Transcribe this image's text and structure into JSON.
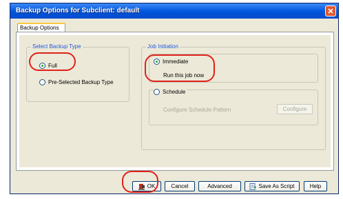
{
  "window": {
    "title": "Backup Options for Subclient: default"
  },
  "tabs": [
    {
      "label": "Backup Options",
      "selected": true
    }
  ],
  "backup_type": {
    "group_title": "Select Backup Type",
    "options": [
      {
        "label": "Full",
        "checked": true
      },
      {
        "label": "Pre-Selected Backup Type",
        "checked": false
      }
    ]
  },
  "job_initiation": {
    "group_title": "Job Initiation",
    "immediate_label": "Immediate",
    "immediate_checked": true,
    "immediate_desc": "Run this job now",
    "schedule_label": "Schedule",
    "schedule_checked": false,
    "schedule_desc": "Configure Schedule Pattern",
    "configure_label": "Configure"
  },
  "footer": {
    "ok_label": "OK",
    "cancel_label": "Cancel",
    "advanced_label": "Advanced",
    "save_script_label": "Save As Script",
    "help_label": "Help"
  },
  "colors": {
    "titlebar": "#0a5de0",
    "group_title": "#2157d8",
    "annotation": "#e0201a"
  }
}
